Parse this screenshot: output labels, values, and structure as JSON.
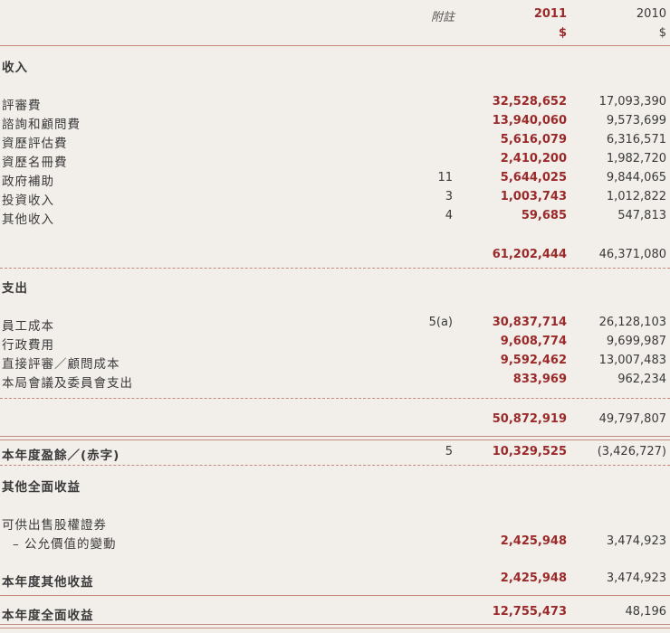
{
  "header": {
    "note": "附註",
    "y2011": "2011",
    "y2011_unit": "$",
    "y2010": "2010",
    "y2010_unit": "$"
  },
  "sections": {
    "income_title": "收入",
    "expense_title": "支出",
    "surplus_label": "本年度盈餘／(赤字)",
    "surplus_note": "5",
    "surplus_2011": "10,329,525",
    "surplus_2010": "(3,426,727)",
    "oci_title": "其他全面收益",
    "oci_sub": "可供出售股權證券",
    "oci_item": "– 公允價值的變動",
    "oci_item_2011": "2,425,948",
    "oci_item_2010": "3,474,923",
    "oci_total_label": "本年度其他收益",
    "oci_total_2011": "2,425,948",
    "oci_total_2010": "3,474,923",
    "total_label": "本年度全面收益",
    "total_2011": "12,755,473",
    "total_2010": "48,196"
  },
  "income": [
    {
      "label": "評審費",
      "note": "",
      "y2011": "32,528,652",
      "y2010": "17,093,390"
    },
    {
      "label": "諮詢和顧問費",
      "note": "",
      "y2011": "13,940,060",
      "y2010": "9,573,699"
    },
    {
      "label": "資歷評估費",
      "note": "",
      "y2011": "5,616,079",
      "y2010": "6,316,571"
    },
    {
      "label": "資歷名冊費",
      "note": "",
      "y2011": "2,410,200",
      "y2010": "1,982,720"
    },
    {
      "label": "政府補助",
      "note": "11",
      "y2011": "5,644,025",
      "y2010": "9,844,065"
    },
    {
      "label": "投資收入",
      "note": "3",
      "y2011": "1,003,743",
      "y2010": "1,012,822"
    },
    {
      "label": "其他收入",
      "note": "4",
      "y2011": "59,685",
      "y2010": "547,813"
    }
  ],
  "income_total": {
    "y2011": "61,202,444",
    "y2010": "46,371,080"
  },
  "expense": [
    {
      "label": "員工成本",
      "note": "5(a)",
      "y2011": "30,837,714",
      "y2010": "26,128,103"
    },
    {
      "label": "行政費用",
      "note": "",
      "y2011": "9,608,774",
      "y2010": "9,699,987"
    },
    {
      "label": "直接評審／顧問成本",
      "note": "",
      "y2011": "9,592,462",
      "y2010": "13,007,483"
    },
    {
      "label": "本局會議及委員會支出",
      "note": "",
      "y2011": "833,969",
      "y2010": "962,234"
    }
  ],
  "expense_total": {
    "y2011": "50,872,919",
    "y2010": "49,797,807"
  }
}
